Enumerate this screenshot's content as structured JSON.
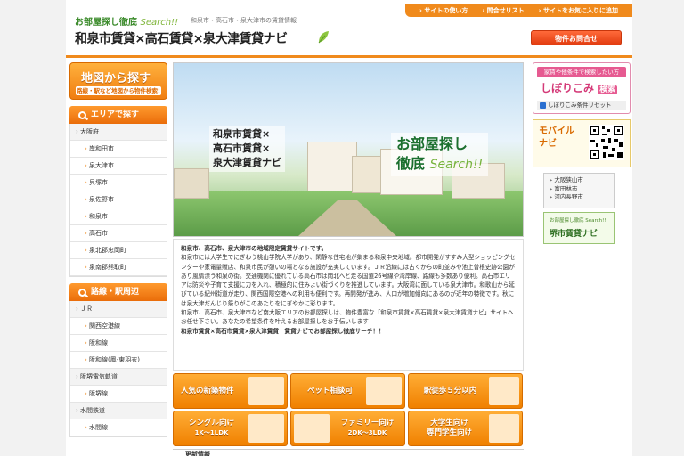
{
  "header": {
    "logo_small": "お部屋探し徹底",
    "logo_search": "Search!!",
    "tagline": "和泉市・高石市・泉大津市の賃貸情報",
    "title": "和泉市賃貸×高石賃貸×泉大津賃貸ナビ",
    "nav": [
      "サイトの使い方",
      "問合せリスト",
      "サイトをお気に入りに追加"
    ],
    "inquiry_button": "物件お問合せ"
  },
  "left": {
    "map": {
      "title": "地図から探す",
      "sub": "路線・駅など地図から物件検索!"
    },
    "area_heading": "エリアで探す",
    "area_items": [
      {
        "label": "大阪府",
        "type": "top"
      },
      {
        "label": "岸和田市",
        "type": "sub"
      },
      {
        "label": "泉大津市",
        "type": "sub"
      },
      {
        "label": "貝塚市",
        "type": "sub"
      },
      {
        "label": "泉佐野市",
        "type": "sub"
      },
      {
        "label": "和泉市",
        "type": "sub"
      },
      {
        "label": "高石市",
        "type": "sub"
      },
      {
        "label": "泉北郡忠岡町",
        "type": "sub"
      },
      {
        "label": "泉南郡熊取町",
        "type": "sub"
      }
    ],
    "line_heading": "路線・駅周辺",
    "line_items": [
      {
        "label": "ＪＲ",
        "type": "top"
      },
      {
        "label": "関西空港線",
        "type": "sub"
      },
      {
        "label": "阪和線",
        "type": "sub"
      },
      {
        "label": "阪和線(鳳-東羽衣)",
        "type": "sub"
      },
      {
        "label": "阪堺電気軌道",
        "type": "top"
      },
      {
        "label": "阪堺線",
        "type": "sub"
      },
      {
        "label": "水間鉄道",
        "type": "top"
      },
      {
        "label": "水間線",
        "type": "sub"
      }
    ]
  },
  "hero": {
    "left_lines": [
      "和泉市賃貸×",
      "高石市賃貸×",
      "泉大津賃貸ナビ"
    ],
    "right_line1": "お部屋探し",
    "right_line2": "徹底",
    "right_search": "Search!!"
  },
  "intro": {
    "heading": "和泉市、高石市、泉大津市の地域限定賃貸サイトです。",
    "body": "和泉市には大学生でにぎわう桃山学院大学があり、閑静な住宅地が集まる和泉中央地域。都市開発がすすみ大型ショッピングセンターや家電量販店、和泉市民が憩いの場となる施設が充実しています。ＪＲ沿線には古くからの町並みや池上曽根史跡公園があり風情漂う和泉の街。交通機関に優れている高石市は南北へと走る国道26号線や湾岸線、路線も多数あり便利。高石市エリアは防災や子育て支援に力を入れ、積極的に住みよい街づくりを推進しています。大阪湾に面している泉大津市。和歌山から延びている紀州街道が走り、関西国際空港への利用も便利です。再開発が進み、人口が増加傾向にあるのが近年の特徴です。秋には泉大津だんじり祭りがこのあたりをにぎやかに彩ります。",
    "body2": "和泉市、高石市、泉大津市など南大阪エリアのお部屋探しは、物件豊富な「和泉市賃貸×高石賃貸×泉大津賃貸ナビ」サイトへお任せ下さい。あなたの希望条件を叶えるお部屋探しをお手伝いします！",
    "footer": "和泉市賃貸×高石市賃貸×泉大津賃貸　賃貸ナビでお部屋探し徹底サーチ！！"
  },
  "features": [
    {
      "label": "人気の新築物件",
      "sub": ""
    },
    {
      "label": "ペット相談可",
      "sub": ""
    },
    {
      "label": "駅徒歩５分以内",
      "sub": ""
    },
    {
      "label": "シングル向け",
      "sub": "1K〜1LDK"
    },
    {
      "label": "ファミリー向け",
      "sub": "2DK〜3LDK"
    },
    {
      "label": "大学生向け",
      "sub": "専門学生向け"
    }
  ],
  "bottom_heading": "更新情報",
  "right": {
    "shibori": {
      "top": "家賃や他条件で検索したい方",
      "main": "しぼりこみ",
      "key": "検索",
      "reset": "しぼりこみ条件リセット"
    },
    "mobile": {
      "l1": "モバイル",
      "l2": "ナビ"
    },
    "ad1": [
      "大阪狭山市",
      "富田林市",
      "河内長野市"
    ],
    "ad2": {
      "small": "お部屋探し徹底 Search!!",
      "big": "堺市賃貸ナビ"
    }
  },
  "colors": {
    "accent": "#f08a1c",
    "title_green": "#3a8a2a",
    "button_red": "#e23c10",
    "pink": "#e65a91"
  }
}
